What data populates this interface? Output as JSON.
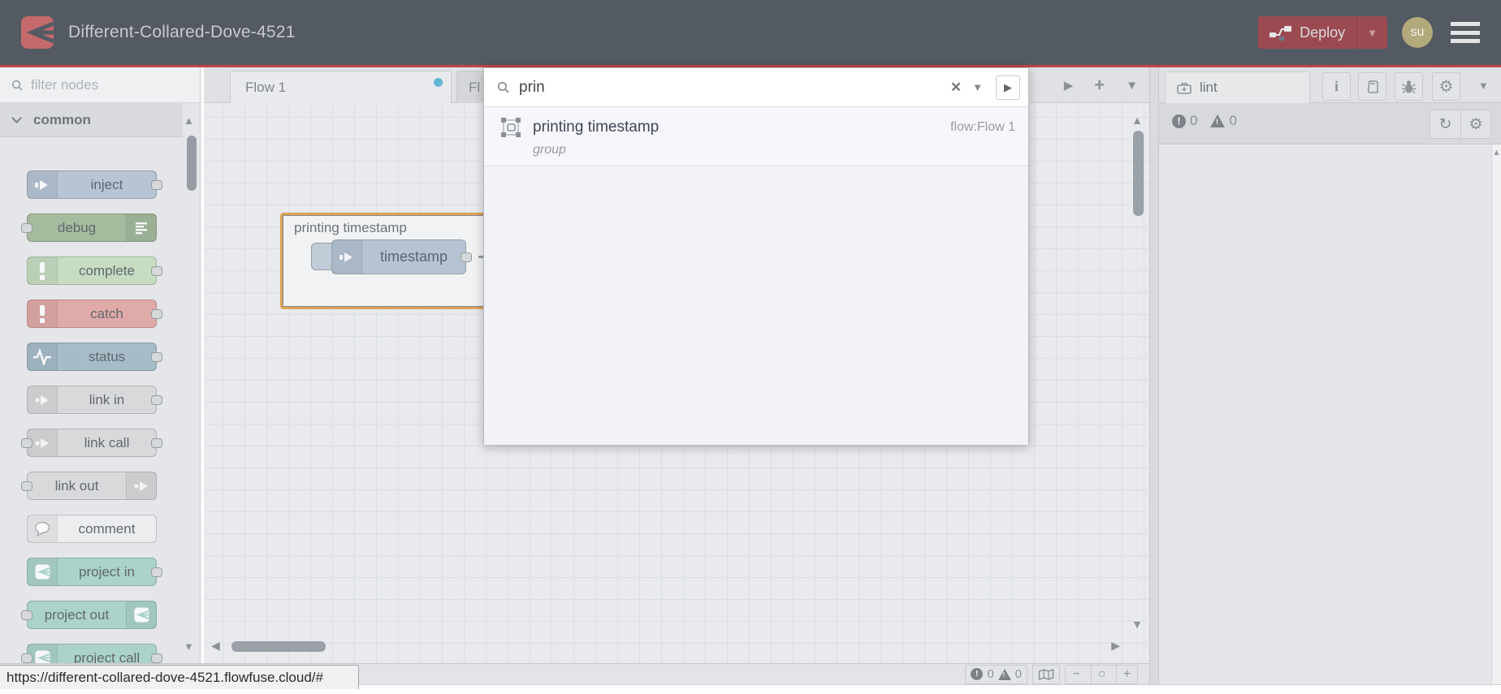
{
  "header": {
    "title": "Different-Collared-Dove-4521",
    "deploy_label": "Deploy",
    "avatar_initials": "su"
  },
  "colors": {
    "header_bg": "#545a61",
    "accent_red": "#c04448",
    "brand_red": "#c56a6c",
    "deploy_bg": "#9c4a52",
    "tab_dirty_dot": "#62b6d3",
    "group_border": "#dfa257",
    "project_teal": "#abd3ca"
  },
  "palette": {
    "filter_placeholder": "filter nodes",
    "category": "common",
    "nodes": [
      {
        "label": "inject",
        "color": "#b6c4d4",
        "icon": "inject-icon",
        "icon_side": "left",
        "ports": [
          "right"
        ]
      },
      {
        "label": "debug",
        "color": "#a4bb9e",
        "icon": "list-icon",
        "icon_side": "right",
        "ports": [
          "left"
        ]
      },
      {
        "label": "complete",
        "color": "#c6ddc2",
        "icon": "excl-icon",
        "icon_side": "left",
        "ports": [
          "right"
        ]
      },
      {
        "label": "catch",
        "color": "#e0aaa8",
        "icon": "excl-icon",
        "icon_side": "left",
        "ports": [
          "right"
        ]
      },
      {
        "label": "status",
        "color": "#a6bcc9",
        "icon": "pulse-icon",
        "icon_side": "left",
        "ports": [
          "right"
        ]
      },
      {
        "label": "link in",
        "color": "#d8d9db",
        "icon": "link-icon",
        "icon_side": "left",
        "ports": [
          "right"
        ]
      },
      {
        "label": "link call",
        "color": "#d8d9db",
        "icon": "link-icon",
        "icon_side": "left",
        "ports": [
          "left",
          "right"
        ]
      },
      {
        "label": "link out",
        "color": "#d8d9db",
        "icon": "link-icon",
        "icon_side": "right",
        "ports": [
          "left"
        ]
      },
      {
        "label": "comment",
        "color": "#ecedee",
        "icon": "comment-icon",
        "icon_side": "left",
        "ports": []
      },
      {
        "label": "project in",
        "color": "#abd3ca",
        "icon": "flowfuse-icon",
        "icon_side": "left",
        "ports": [
          "right"
        ]
      },
      {
        "label": "project out",
        "color": "#abd3ca",
        "icon": "flowfuse-icon",
        "icon_side": "right",
        "ports": [
          "left"
        ]
      },
      {
        "label": "project call",
        "color": "#abd3ca",
        "icon": "flowfuse-icon",
        "icon_side": "left",
        "ports": [
          "left",
          "right"
        ]
      }
    ]
  },
  "tabs": {
    "active": "Flow 1",
    "partial": "Fl"
  },
  "canvas": {
    "group_label": "printing timestamp",
    "node_label": "timestamp"
  },
  "search": {
    "value": "prin",
    "results": [
      {
        "title": "printing timestamp",
        "meta": "flow:Flow 1",
        "kind": "group"
      }
    ]
  },
  "sidebar": {
    "tab_label": "lint",
    "errors": "0",
    "warnings": "0"
  },
  "footer": {
    "errors": "0",
    "warnings": "0",
    "zoom_out": "−",
    "zoom_reset": "○",
    "zoom_in": "+"
  },
  "statusbar": {
    "url": "https://different-collared-dove-4521.flowfuse.cloud/#"
  }
}
